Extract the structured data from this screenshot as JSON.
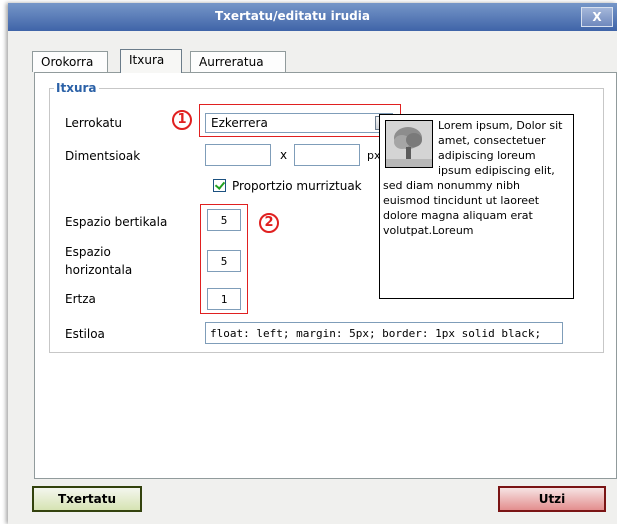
{
  "dialog": {
    "title": "Txertatu/editatu irudia",
    "close_label": "X"
  },
  "tabs": [
    {
      "label": "Orokorra"
    },
    {
      "label": "Itxura",
      "active": true
    },
    {
      "label": "Aurreratua"
    }
  ],
  "fieldset": {
    "legend": "Itxura"
  },
  "fields": {
    "align_label": "Lerrokatu",
    "align_value": "Ezkerrera",
    "dimensions_label": "Dimentsioak",
    "width_value": "",
    "height_value": "",
    "dim_separator": "x",
    "dim_unit": "px",
    "constrain_label": "Proportzio murriztuak",
    "vspace_label": "Espazio bertikala",
    "vspace_value": "5",
    "hspace_label_line1": "Espazio",
    "hspace_label_line2": "horizontala",
    "hspace_value": "5",
    "border_label": "Ertza",
    "border_value": "1",
    "style_label": "Estiloa",
    "style_value": "float: left; margin: 5px; border: 1px solid black;"
  },
  "annotations": {
    "marker1": "1",
    "marker2": "2"
  },
  "preview": {
    "text": "Lorem ipsum, Dolor sit amet, consectetuer adipiscing loreum ipsum edipiscing elit, sed diam nonummy nibh euismod tincidunt ut laoreet dolore magna aliquam erat volutpat.Loreum"
  },
  "buttons": {
    "insert_label": "Txertatu",
    "cancel_label": "Utzi"
  },
  "colors": {
    "title_bar": "#4a6fb0",
    "legend": "#2b61a7",
    "annotation": "#e02020"
  }
}
